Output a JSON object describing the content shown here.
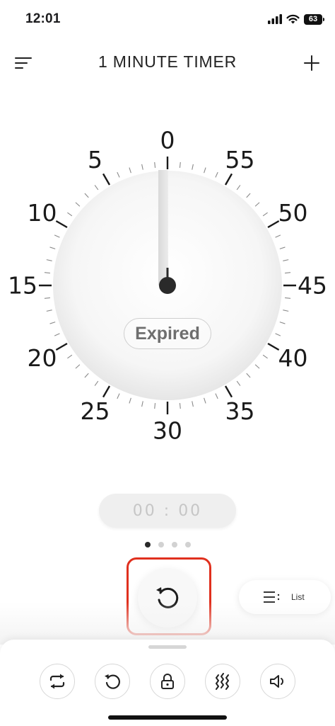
{
  "status_bar": {
    "time": "12:01",
    "battery": "63"
  },
  "header": {
    "title": "1 MINUTE TIMER"
  },
  "dial": {
    "numbers": [
      "0",
      "5",
      "10",
      "15",
      "20",
      "25",
      "30",
      "35",
      "40",
      "45",
      "50",
      "55"
    ],
    "status": "Expired"
  },
  "readout": {
    "time": "00 : 00"
  },
  "pager": {
    "count": 4,
    "active": 0
  },
  "list_button": {
    "label": "List"
  },
  "bottom_icons": [
    "repeat-icon",
    "reset-icon",
    "lock-icon",
    "vibration-icon",
    "sound-icon"
  ],
  "colors": {
    "highlight": "#e0301e",
    "hand": "#2a2a2a"
  }
}
